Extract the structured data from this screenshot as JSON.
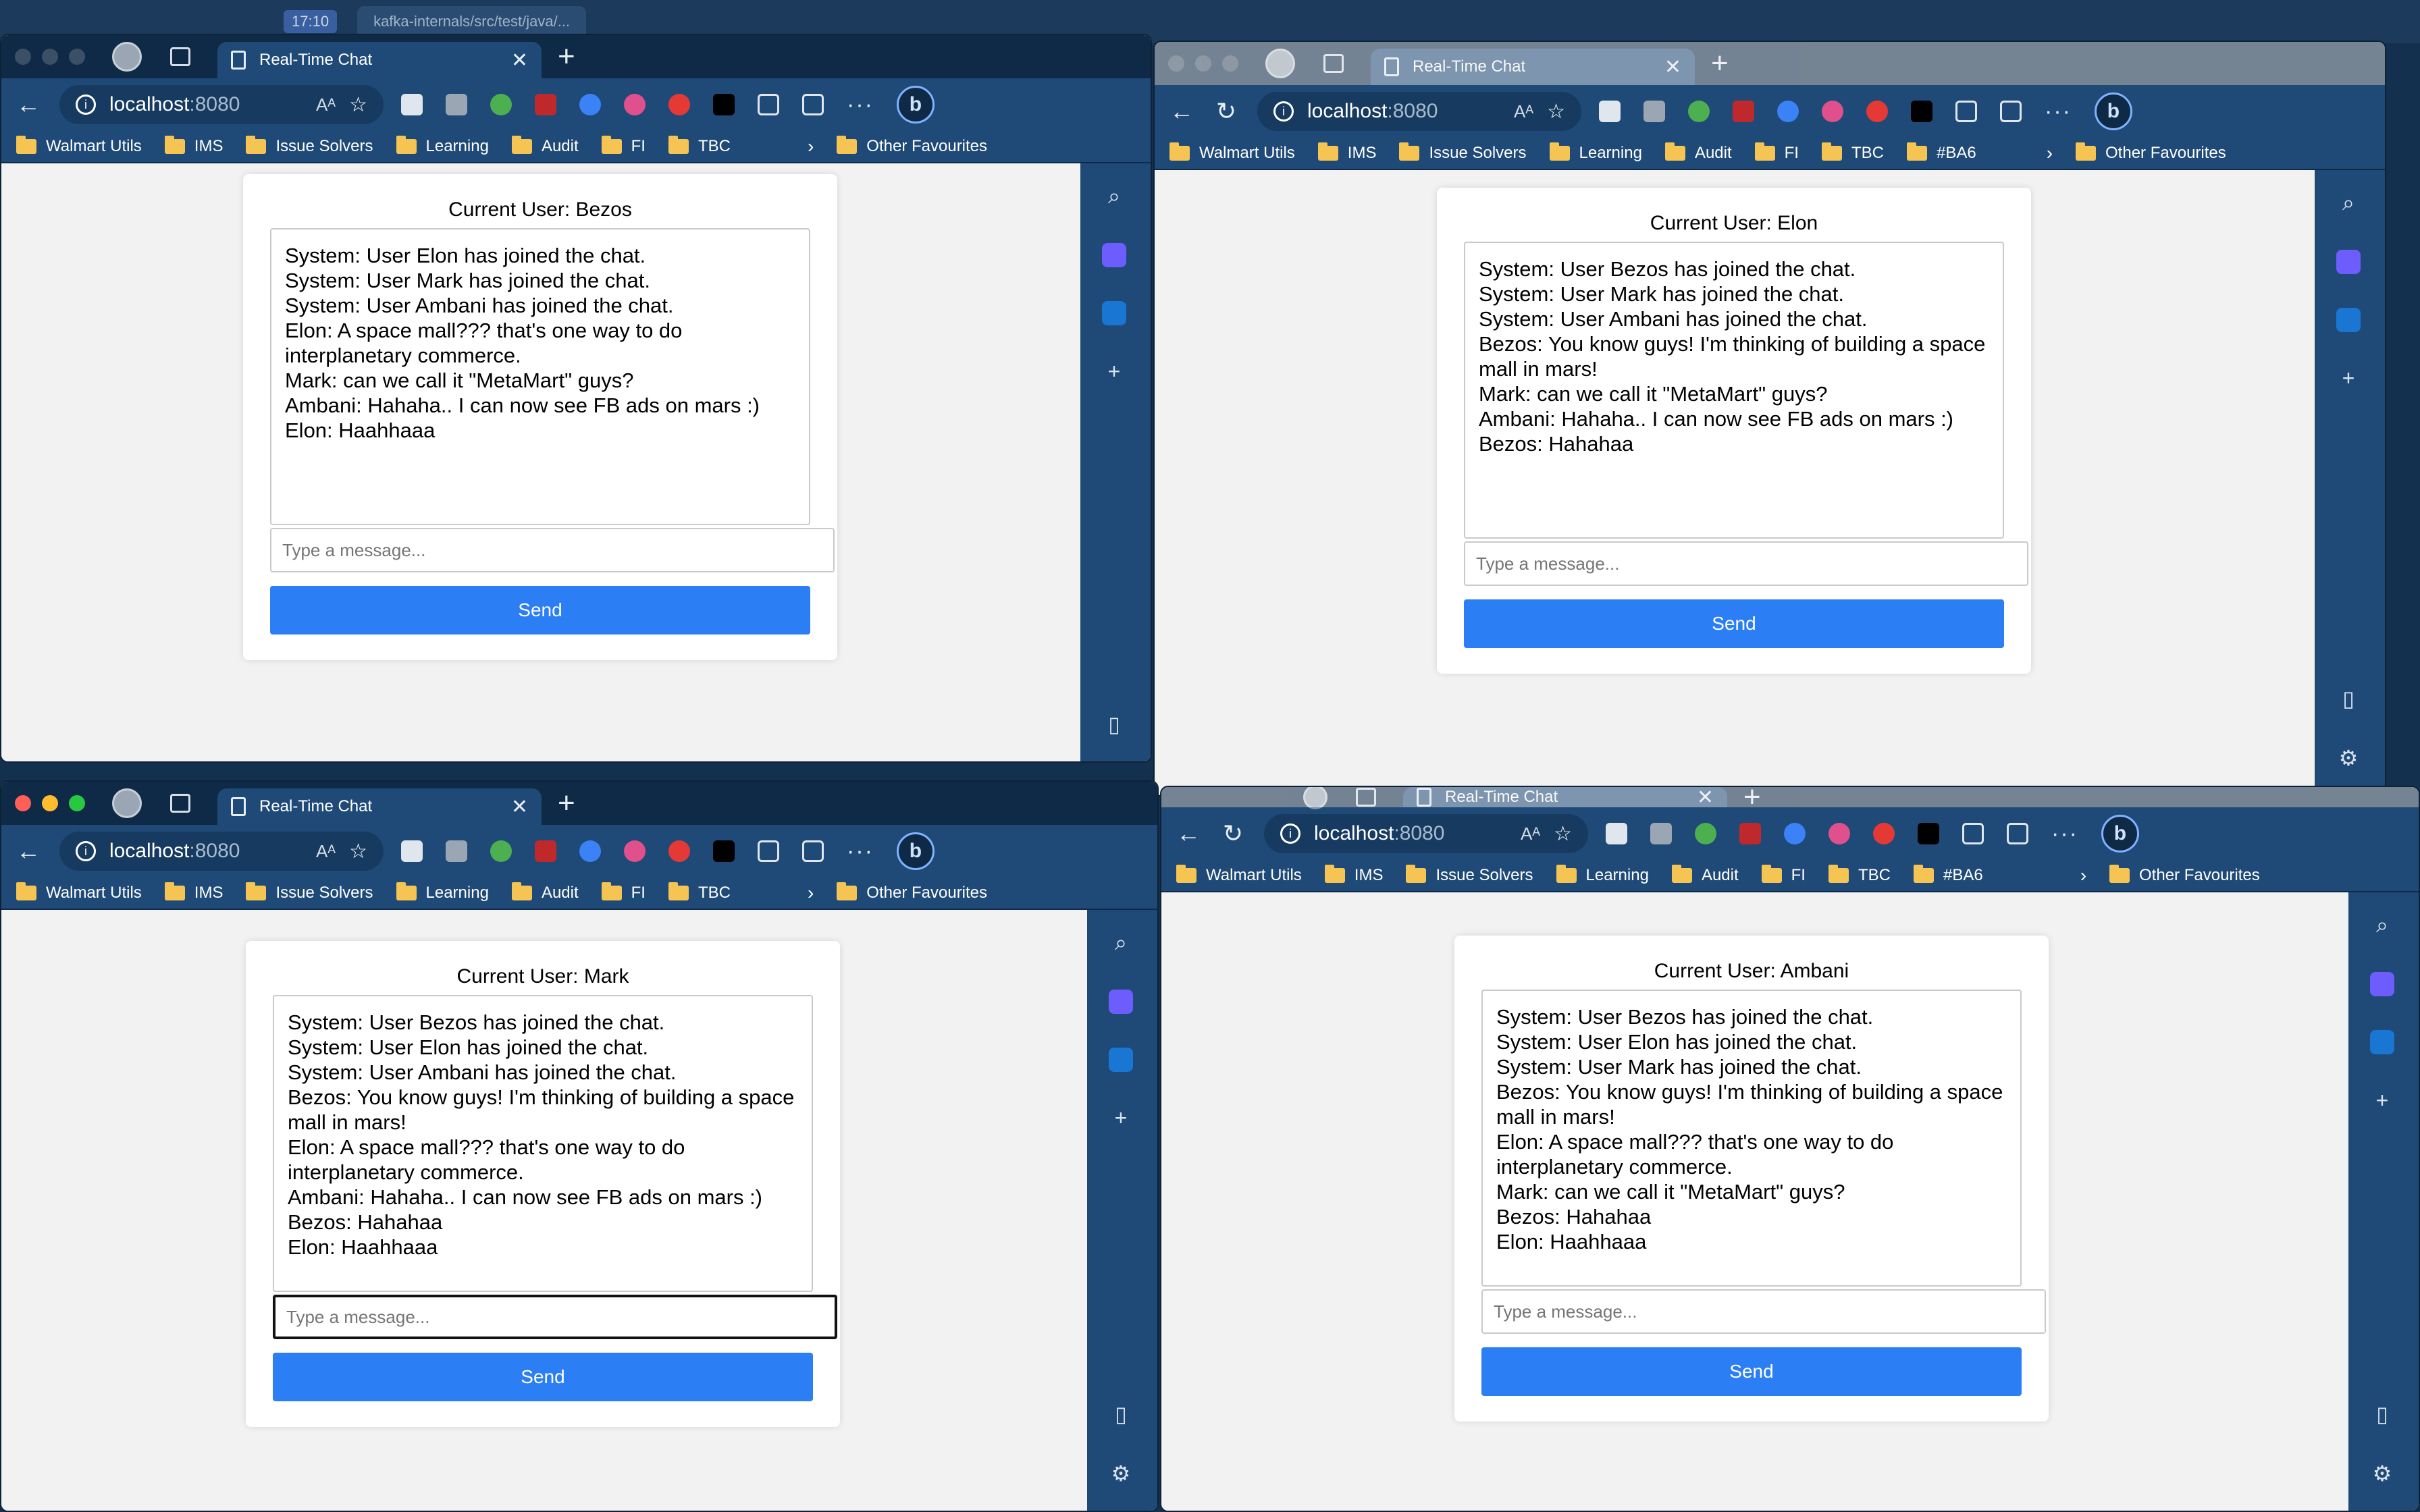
{
  "desktop": {
    "mac_tab_time": "17:10",
    "mac_tab_title": "kafka-internals/src/test/java/..."
  },
  "browser": {
    "tab_title": "Real-Time Chat",
    "address_host": "localhost",
    "address_port": ":8080",
    "read_aloud": "Aᴬ",
    "bookmarks": [
      "Walmart Utils",
      "IMS",
      "Issue Solvers",
      "Learning",
      "Audit",
      "FI",
      "TBC"
    ],
    "bookmarks_extra": "#BA6",
    "other_favourites": "Other Favourites"
  },
  "windows": [
    {
      "current_user": "Current User: Bezos",
      "messages": [
        "System: User Elon has joined the chat.",
        "System: User Mark has joined the chat.",
        "System: User Ambani has joined the chat.",
        "Elon: A space mall??? that's one way to do interplanetary commerce.",
        "Mark: can we call it \"MetaMart\" guys?",
        "Ambani: Hahaha.. I can now see FB ads on mars :)",
        "Elon: Haahhaaa"
      ],
      "placeholder": "Type a message...",
      "send_label": "Send"
    },
    {
      "current_user": "Current User: Elon",
      "messages": [
        "System: User Bezos has joined the chat.",
        "System: User Mark has joined the chat.",
        "System: User Ambani has joined the chat.",
        "Bezos: You know guys! I'm thinking of building a space mall in mars!",
        "Mark: can we call it \"MetaMart\" guys?",
        "Ambani: Hahaha.. I can now see FB ads on mars :)",
        "Bezos: Hahahaa"
      ],
      "placeholder": "Type a message...",
      "send_label": "Send"
    },
    {
      "current_user": "Current User: Mark",
      "messages": [
        "System: User Bezos has joined the chat.",
        "System: User Elon has joined the chat.",
        "System: User Ambani has joined the chat.",
        "Bezos: You know guys! I'm thinking of building a space mall in mars!",
        "Elon: A space mall??? that's one way to do interplanetary commerce.",
        "Ambani: Hahaha.. I can now see FB ads on mars :)",
        "Bezos: Hahahaa",
        "Elon: Haahhaaa"
      ],
      "placeholder": "Type a message...",
      "send_label": "Send"
    },
    {
      "current_user": "Current User: Ambani",
      "messages": [
        "System: User Bezos has joined the chat.",
        "System: User Elon has joined the chat.",
        "System: User Mark has joined the chat.",
        "Bezos: You know guys! I'm thinking of building a space mall in mars!",
        "Elon: A space mall??? that's one way to do interplanetary commerce.",
        "Mark: can we call it \"MetaMart\" guys?",
        "Bezos: Hahahaa",
        "Elon: Haahhaaa"
      ],
      "placeholder": "Type a message...",
      "send_label": "Send"
    }
  ],
  "colors": {
    "send_button": "#2c7ef5",
    "chrome": "#1f4a77",
    "tabstrip": "#0f2a46"
  }
}
